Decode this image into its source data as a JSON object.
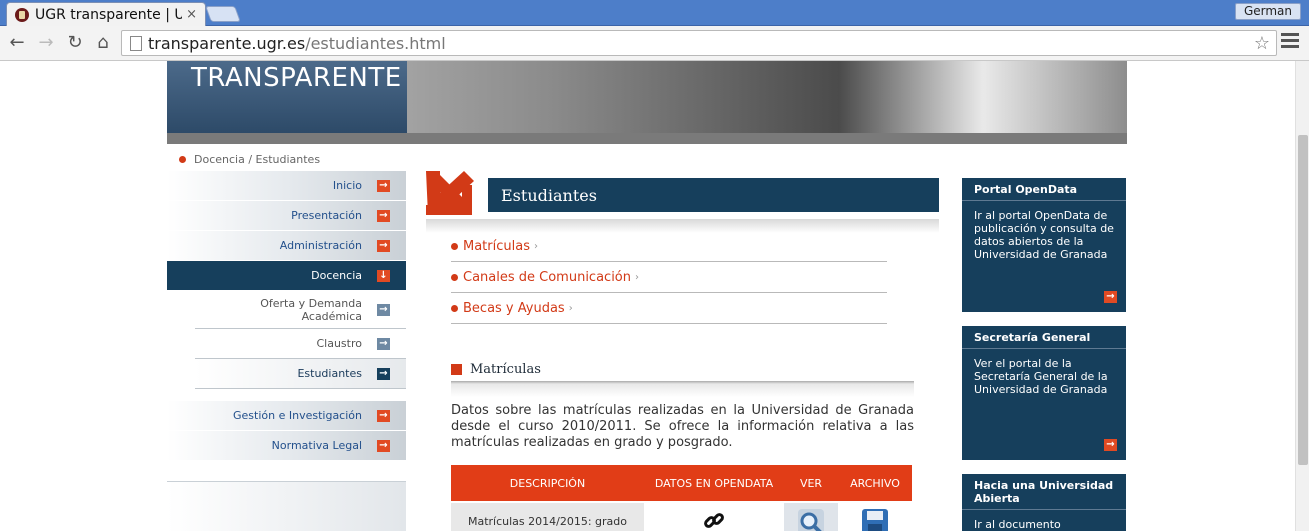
{
  "browser": {
    "tab_title": "UGR transparente | U",
    "tab_close": "×",
    "profile": "German",
    "url_domain": "transparente.ugr.es",
    "url_path": "/estudiantes.html",
    "nav": {
      "back": "←",
      "forward": "→",
      "reload": "↻",
      "home": "⌂",
      "star": "☆"
    }
  },
  "banner": {
    "title": "TRANSPARENTE"
  },
  "breadcrumb": "Docencia / Estudiantes",
  "leftnav": {
    "items": [
      {
        "label": "Inicio",
        "arrow": "→"
      },
      {
        "label": "Presentación",
        "arrow": "→"
      },
      {
        "label": "Administración",
        "arrow": "→"
      },
      {
        "label": "Docencia",
        "arrow": "↓"
      }
    ],
    "sub_items": [
      {
        "label": "Oferta y Demanda Académica",
        "arrow": "→"
      },
      {
        "label": "Claustro",
        "arrow": "→"
      },
      {
        "label": "Estudiantes",
        "arrow": "→"
      }
    ],
    "items_after": [
      {
        "label": "Gestión e Investigación",
        "arrow": "→"
      },
      {
        "label": "Normativa Legal",
        "arrow": "→"
      }
    ]
  },
  "main": {
    "section_title": "Estudiantes",
    "links": [
      {
        "label": "Matrículas",
        "chev": "›"
      },
      {
        "label": "Canales de Comunicación",
        "chev": "›"
      },
      {
        "label": "Becas y Ayudas",
        "chev": "›"
      }
    ],
    "subsection_title": "Matrículas",
    "description": "Datos sobre las matrículas realizadas en la Universidad de Granada desde el curso 2010/2011. Se ofrece la información relativa a las matrículas realizadas en grado y posgrado.",
    "table": {
      "headers": [
        "DESCRIPCIÓN",
        "DATOS EN OPENDATA",
        "VER",
        "ARCHIVO"
      ],
      "rows": [
        {
          "description": "Matrículas 2014/2015: grado"
        }
      ]
    }
  },
  "rightcol": [
    {
      "title": "Portal OpenData",
      "text": "Ir al portal OpenData de publicación y consulta de datos abiertos de la Universidad de Granada",
      "arrow": "→"
    },
    {
      "title": "Secretaría General",
      "text": "Ver el portal de la Secretaría General de la Universidad de Granada",
      "arrow": "→"
    },
    {
      "title": "Hacia una Universidad Abierta",
      "text": "Ir al documento"
    }
  ],
  "colors": {
    "accent": "#d23a17",
    "navy": "#163f5c",
    "chrome_blue": "#4d7ec9"
  }
}
